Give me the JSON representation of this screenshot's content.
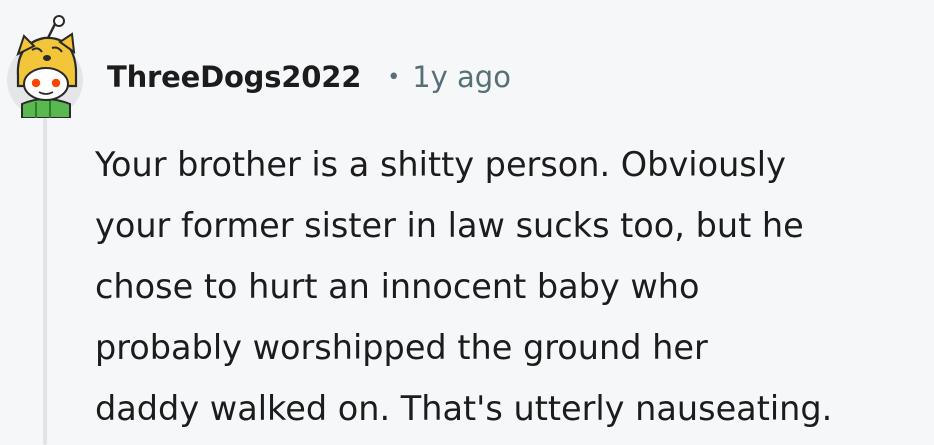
{
  "comment": {
    "author": "ThreeDogs2022",
    "separator": "•",
    "timestamp": "1y ago",
    "avatar_icon": "snoo-avatar-dog-hat-icon",
    "body_lines": [
      "Your brother is a shitty person. Obviously",
      "your former sister in law sucks too, but he",
      "chose to hurt an innocent baby who",
      "probably worshipped the ground her",
      "daddy walked on. That's utterly nauseating."
    ]
  },
  "colors": {
    "background": "#f6f7f8",
    "meta_text": "#576f76",
    "thread_line": "#e1e3e5",
    "avatar_hat": "#f3c63a",
    "avatar_scarf": "#59b84f"
  }
}
